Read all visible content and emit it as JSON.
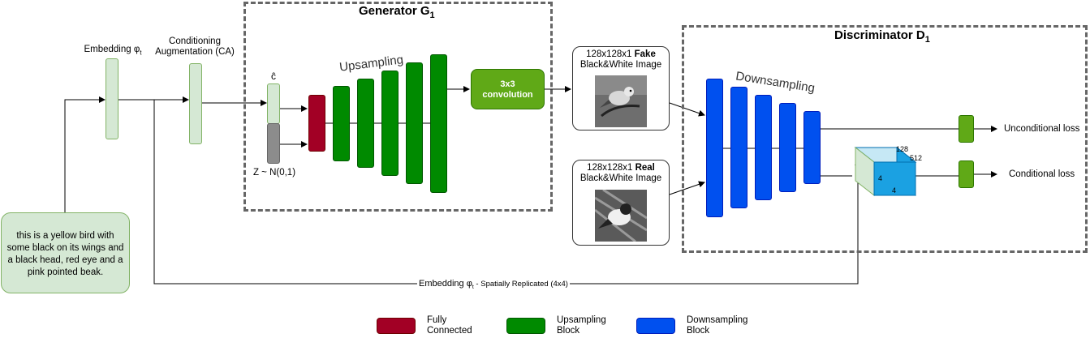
{
  "generator": {
    "title": "Generator G",
    "title_sub": "1",
    "upsampling_label": "Upsampling",
    "conv_label_1": "3x3",
    "conv_label_2": "convolution",
    "c_hat": "ĉ",
    "noise": "Z ~ N(0,1)"
  },
  "discriminator": {
    "title": "Discriminator D",
    "title_sub": "1",
    "downsampling_label": "Downsampling"
  },
  "embedding": {
    "label": "Embedding φ",
    "sub": "t"
  },
  "ca": {
    "line1": "Conditioning",
    "line2": "Augmentation (CA)"
  },
  "text_input": {
    "lines": [
      "this is a yellow bird with",
      "some black on its wings and",
      "a black head, red eye and a",
      "pink pointed beak."
    ]
  },
  "fake_image": {
    "line1_prefix": "128x128x1 ",
    "line1_bold": "Fake",
    "line2": "Black&White Image"
  },
  "real_image": {
    "line1_prefix": "128x128x1 ",
    "line1_bold": "Real",
    "line2": "Black&White Image"
  },
  "cube": {
    "top": "128",
    "right": "512",
    "left": "4",
    "bottom": "4"
  },
  "outputs": {
    "unconditional": "Unconditional loss",
    "conditional": "Conditional loss"
  },
  "replicated": {
    "prefix": "Embedding φ",
    "sub": "t",
    "suffix": " - Spatially Replicated (4x4)"
  },
  "legend": [
    {
      "line1": "Fully",
      "line2": "Connected",
      "color": "#a20025"
    },
    {
      "line1": "Upsampling",
      "line2": "Block",
      "color": "#008a00"
    },
    {
      "line1": "Downsampling",
      "line2": "Block",
      "color": "#0050ef"
    }
  ]
}
